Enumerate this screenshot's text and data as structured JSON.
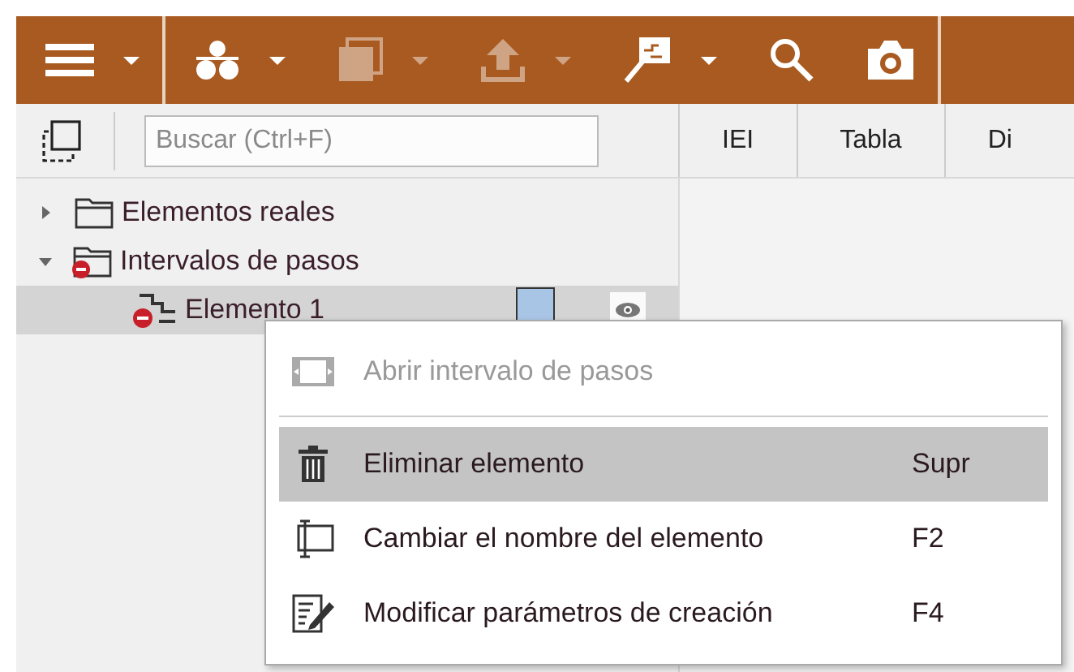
{
  "toolbar": {
    "buttons": [
      {
        "disabled": false,
        "dropdown": true
      },
      {
        "disabled": false,
        "dropdown": true
      },
      {
        "disabled": true,
        "dropdown": true
      },
      {
        "disabled": true,
        "dropdown": true
      },
      {
        "disabled": false,
        "dropdown": true
      },
      {
        "disabled": false,
        "dropdown": false
      },
      {
        "disabled": false,
        "dropdown": false
      }
    ]
  },
  "search": {
    "placeholder": "Buscar (Ctrl+F)"
  },
  "tabs": [
    {
      "label": "IEI",
      "selected": false
    },
    {
      "label": "Tabla",
      "selected": false
    },
    {
      "label": "Di",
      "selected": false
    }
  ],
  "tree": [
    {
      "label": "Elementos reales",
      "expanded": false,
      "selected": false
    },
    {
      "label": "Intervalos de pasos",
      "expanded": true,
      "selected": false,
      "children": [
        {
          "label": "Elemento 1",
          "selected": true,
          "color": "#a9c5e6",
          "visible": true
        }
      ]
    }
  ],
  "context_menu": [
    {
      "kind": "item",
      "label": "Abrir intervalo de pasos",
      "disabled": true,
      "selected": false
    },
    {
      "kind": "separator"
    },
    {
      "kind": "item",
      "label": "Eliminar elemento",
      "shortcut": "Supr",
      "disabled": false,
      "selected": true
    },
    {
      "kind": "item",
      "label": "Cambiar el nombre del elemento",
      "shortcut": "F2",
      "disabled": false,
      "selected": false
    },
    {
      "kind": "item",
      "label": "Modificar parámetros de creación",
      "shortcut": "F4",
      "disabled": false,
      "selected": false
    }
  ]
}
